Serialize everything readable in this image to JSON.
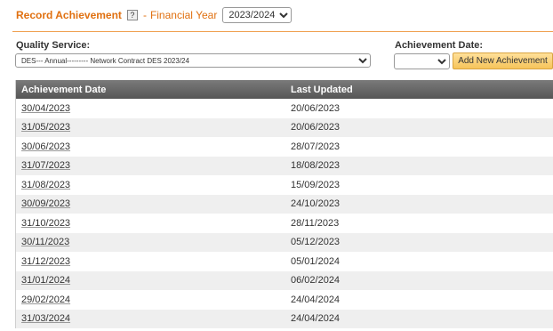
{
  "header": {
    "title": "Record Achievement",
    "help_icon": "?",
    "separator": "-",
    "fy_label": "Financial Year",
    "fy_value": "2023/2024"
  },
  "form": {
    "quality_service_label": "Quality Service:",
    "quality_service_value": "DES--- Annual--------- Network Contract DES 2023/24",
    "achievement_date_label": "Achievement Date:",
    "achievement_date_value": "",
    "add_button_label": "Add New Achievement"
  },
  "colors": {
    "accent": "#e07010",
    "rule": "#f0a050",
    "header_bg": "#666666",
    "button_bg": "#f6c45a"
  },
  "table": {
    "columns": [
      "Achievement Date",
      "Last Updated"
    ],
    "rows": [
      {
        "date": "30/04/2023",
        "updated": "20/06/2023"
      },
      {
        "date": "31/05/2023",
        "updated": "20/06/2023"
      },
      {
        "date": "30/06/2023",
        "updated": "28/07/2023"
      },
      {
        "date": "31/07/2023",
        "updated": "18/08/2023"
      },
      {
        "date": "31/08/2023",
        "updated": "15/09/2023"
      },
      {
        "date": "30/09/2023",
        "updated": "24/10/2023"
      },
      {
        "date": "31/10/2023",
        "updated": "28/11/2023"
      },
      {
        "date": "30/11/2023",
        "updated": "05/12/2023"
      },
      {
        "date": "31/12/2023",
        "updated": "05/01/2024"
      },
      {
        "date": "31/01/2024",
        "updated": "06/02/2024"
      },
      {
        "date": "29/02/2024",
        "updated": "24/04/2024"
      },
      {
        "date": "31/03/2024",
        "updated": "24/04/2024"
      }
    ]
  }
}
